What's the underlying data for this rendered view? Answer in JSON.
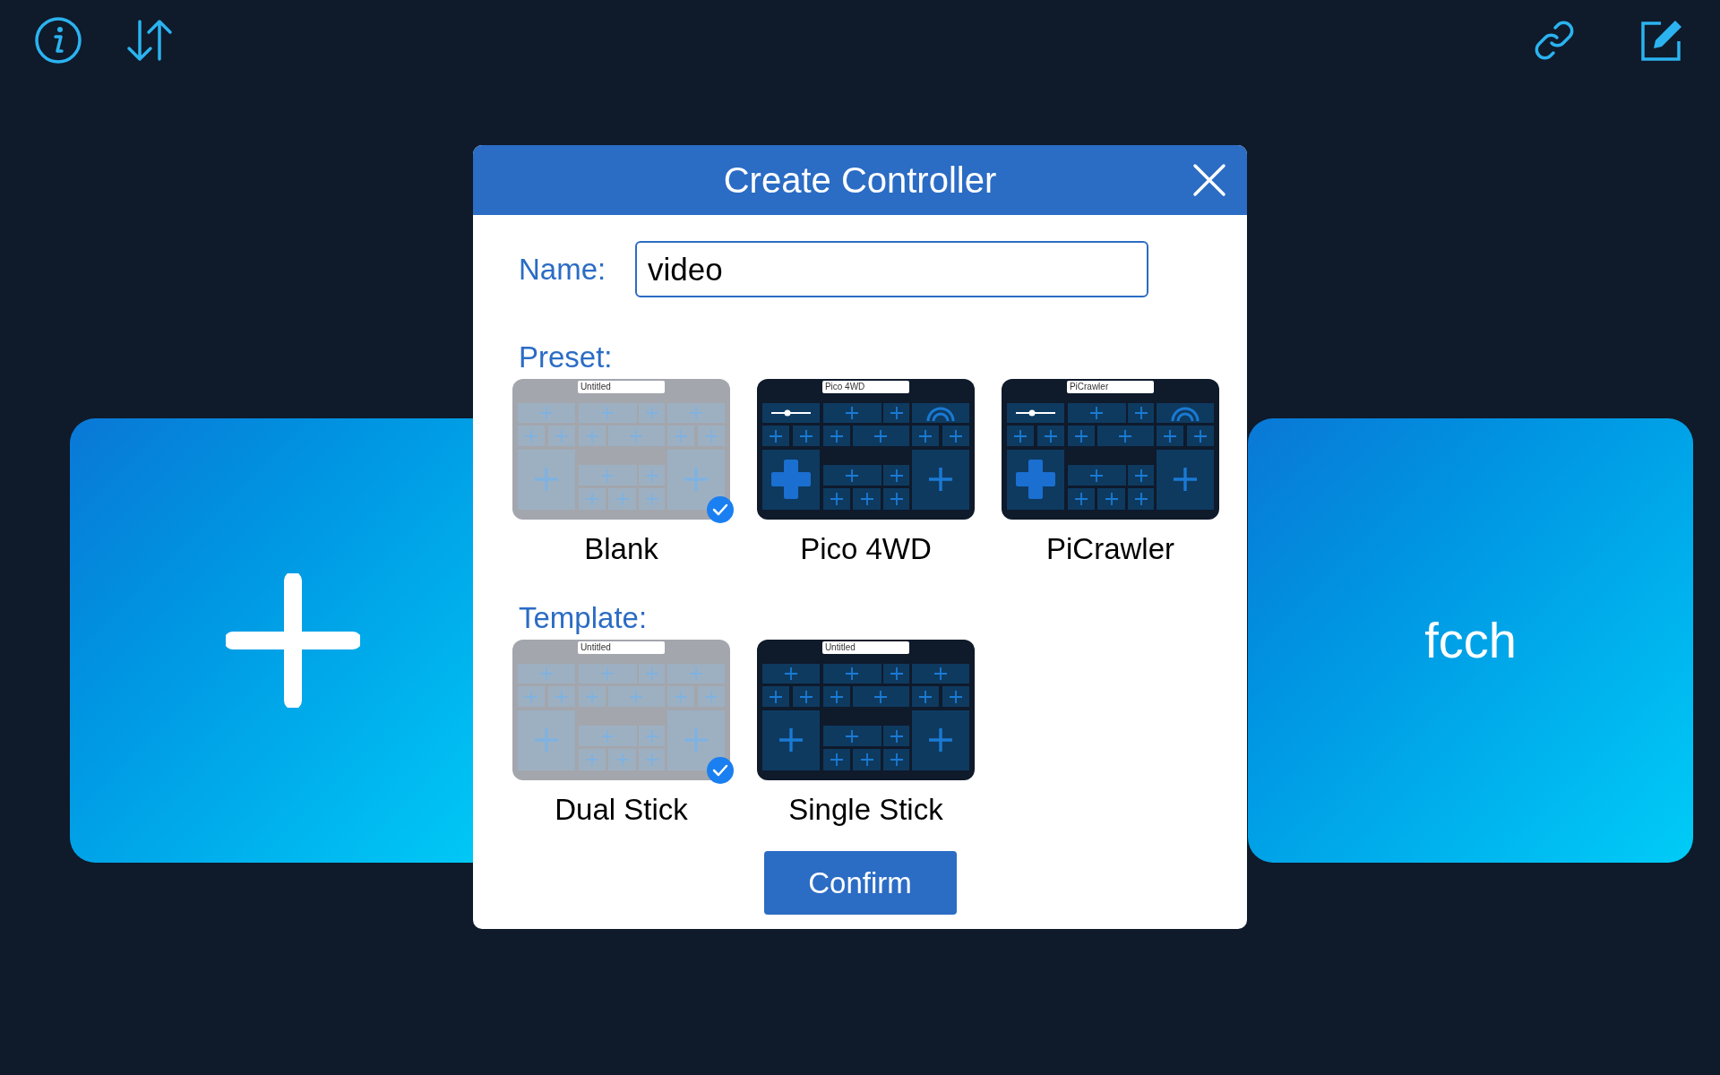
{
  "cards": [
    {
      "kind": "add"
    },
    {
      "kind": "controller",
      "label": "fcch"
    }
  ],
  "dialog": {
    "title": "Create Controller",
    "name_label": "Name:",
    "name_value": "video",
    "sections": [
      {
        "label": "Preset:",
        "items": [
          {
            "label": "Blank",
            "thumbnail_title": "Untitled",
            "kind": "grid",
            "selected": true
          },
          {
            "label": "Pico 4WD",
            "thumbnail_title": "Pico 4WD",
            "kind": "vehicle",
            "selected": false
          },
          {
            "label": "PiCrawler",
            "thumbnail_title": "PiCrawler",
            "kind": "vehicle",
            "selected": false
          }
        ]
      },
      {
        "label": "Template:",
        "items": [
          {
            "label": "Dual Stick",
            "thumbnail_title": "Untitled",
            "kind": "grid",
            "selected": true
          },
          {
            "label": "Single Stick",
            "thumbnail_title": "Untitled",
            "kind": "grid",
            "selected": false
          }
        ]
      }
    ],
    "confirm": "Confirm"
  }
}
